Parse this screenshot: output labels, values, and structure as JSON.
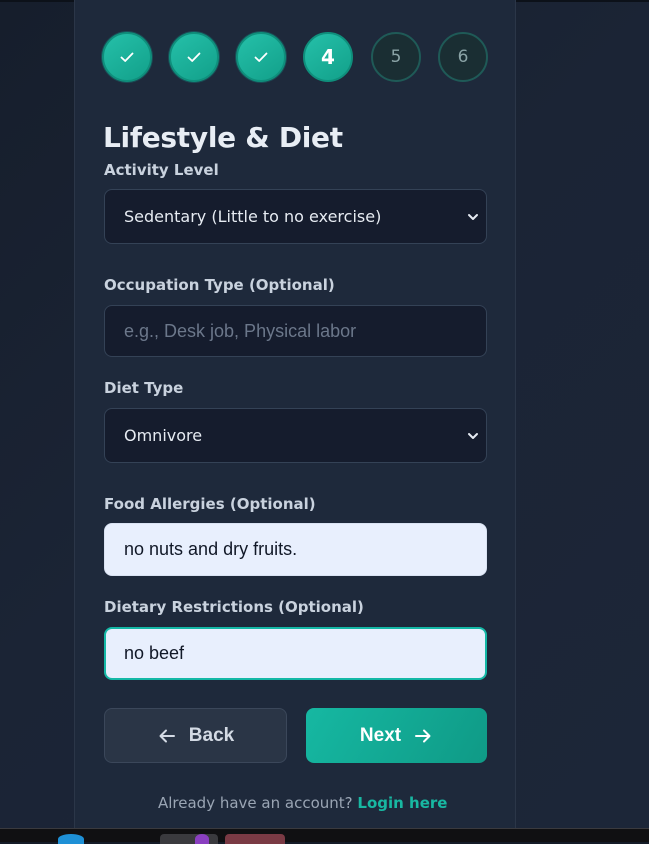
{
  "stepper": {
    "steps": [
      {
        "label": "1",
        "state": "completed",
        "icon": "check-icon"
      },
      {
        "label": "2",
        "state": "completed",
        "icon": "check-icon"
      },
      {
        "label": "3",
        "state": "completed",
        "icon": "check-icon"
      },
      {
        "label": "4",
        "state": "current"
      },
      {
        "label": "5",
        "state": "pending"
      },
      {
        "label": "6",
        "state": "pending"
      }
    ]
  },
  "form": {
    "title": "Lifestyle & Diet",
    "activity_level": {
      "label": "Activity Level",
      "value": "Sedentary (Little to no exercise)"
    },
    "occupation": {
      "label": "Occupation Type (Optional)",
      "value": "",
      "placeholder": "e.g., Desk job, Physical labor"
    },
    "diet_type": {
      "label": "Diet Type",
      "value": "Omnivore"
    },
    "food_allergies": {
      "label": "Food Allergies (Optional)",
      "value": "no nuts and dry fruits."
    },
    "dietary_restrictions": {
      "label": "Dietary Restrictions (Optional)",
      "value": "no beef"
    }
  },
  "actions": {
    "back_label": "Back",
    "next_label": "Next"
  },
  "footer": {
    "prompt": "Already have an account?",
    "login_link": "Login here"
  },
  "colors": {
    "accent": "#14b8a6",
    "card_bg": "#1e293b",
    "page_bg": "#141b27",
    "input_dark_bg": "#151c2d",
    "input_light_bg": "#e8effd"
  }
}
